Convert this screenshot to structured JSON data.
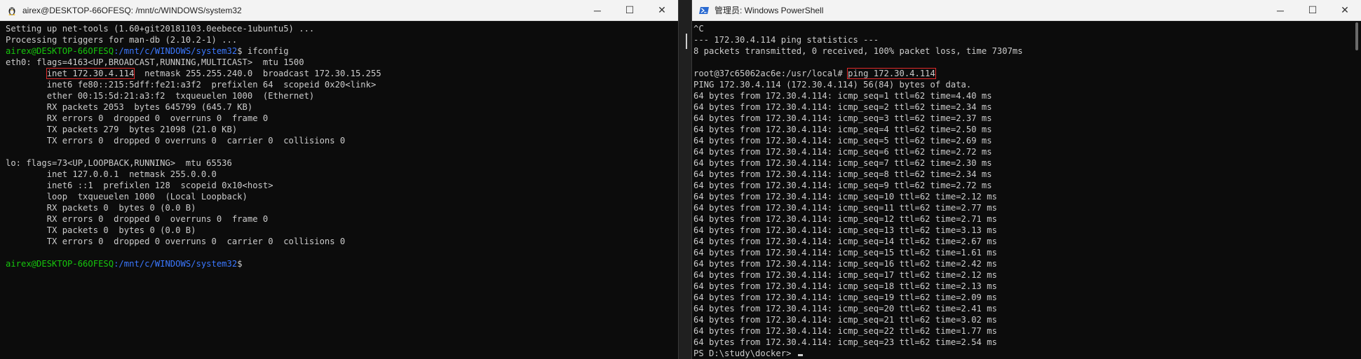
{
  "left_window": {
    "title": "airex@DESKTOP-66OFESQ: /mnt/c/WINDOWS/system32",
    "icon": "linux-penguin-icon",
    "controls": {
      "minimize": "─",
      "maximize": "☐",
      "close": "✕"
    },
    "lines": [
      "Setting up net-tools (1.60+git20181103.0eebece-1ubuntu5) ...",
      "Processing triggers for man-db (2.10.2-1) ...",
      {
        "user": "airex@DESKTOP-66OFESQ",
        "path": ":/mnt/c/WINDOWS/system32",
        "cmd": "$ ifconfig"
      },
      "eth0: flags=4163<UP,BROADCAST,RUNNING,MULTICAST>  mtu 1500",
      {
        "indent": "        ",
        "hl": "inet 172.30.4.114",
        "rest": "  netmask 255.255.240.0  broadcast 172.30.15.255"
      },
      "        inet6 fe80::215:5dff:fe21:a3f2  prefixlen 64  scopeid 0x20<link>",
      "        ether 00:15:5d:21:a3:f2  txqueuelen 1000  (Ethernet)",
      "        RX packets 2053  bytes 645799 (645.7 KB)",
      "        RX errors 0  dropped 0  overruns 0  frame 0",
      "        TX packets 279  bytes 21098 (21.0 KB)",
      "        TX errors 0  dropped 0 overruns 0  carrier 0  collisions 0",
      "",
      "lo: flags=73<UP,LOOPBACK,RUNNING>  mtu 65536",
      "        inet 127.0.0.1  netmask 255.0.0.0",
      "        inet6 ::1  prefixlen 128  scopeid 0x10<host>",
      "        loop  txqueuelen 1000  (Local Loopback)",
      "        RX packets 0  bytes 0 (0.0 B)",
      "        RX errors 0  dropped 0  overruns 0  frame 0",
      "        TX packets 0  bytes 0 (0.0 B)",
      "        TX errors 0  dropped 0 overruns 0  carrier 0  collisions 0",
      "",
      {
        "user": "airex@DESKTOP-66OFESQ",
        "path": ":/mnt/c/WINDOWS/system32",
        "cmd": "$"
      }
    ]
  },
  "right_window": {
    "title": "管理员: Windows PowerShell",
    "icon": "powershell-icon",
    "controls": {
      "minimize": "─",
      "maximize": "☐",
      "close": "✕"
    },
    "lines": [
      "^C",
      "--- 172.30.4.114 ping statistics ---",
      "8 packets transmitted, 0 received, 100% packet loss, time 7307ms",
      "",
      {
        "prefix": "root@37c65062ac6e:/usr/local# ",
        "hl": "ping 172.30.4.114"
      },
      "PING 172.30.4.114 (172.30.4.114) 56(84) bytes of data.",
      "64 bytes from 172.30.4.114: icmp_seq=1 ttl=62 time=4.40 ms",
      "64 bytes from 172.30.4.114: icmp_seq=2 ttl=62 time=2.34 ms",
      "64 bytes from 172.30.4.114: icmp_seq=3 ttl=62 time=2.37 ms",
      "64 bytes from 172.30.4.114: icmp_seq=4 ttl=62 time=2.50 ms",
      "64 bytes from 172.30.4.114: icmp_seq=5 ttl=62 time=2.69 ms",
      "64 bytes from 172.30.4.114: icmp_seq=6 ttl=62 time=2.72 ms",
      "64 bytes from 172.30.4.114: icmp_seq=7 ttl=62 time=2.30 ms",
      "64 bytes from 172.30.4.114: icmp_seq=8 ttl=62 time=2.34 ms",
      "64 bytes from 172.30.4.114: icmp_seq=9 ttl=62 time=2.72 ms",
      "64 bytes from 172.30.4.114: icmp_seq=10 ttl=62 time=2.12 ms",
      "64 bytes from 172.30.4.114: icmp_seq=11 ttl=62 time=2.77 ms",
      "64 bytes from 172.30.4.114: icmp_seq=12 ttl=62 time=2.71 ms",
      "64 bytes from 172.30.4.114: icmp_seq=13 ttl=62 time=3.13 ms",
      "64 bytes from 172.30.4.114: icmp_seq=14 ttl=62 time=2.67 ms",
      "64 bytes from 172.30.4.114: icmp_seq=15 ttl=62 time=1.61 ms",
      "64 bytes from 172.30.4.114: icmp_seq=16 ttl=62 time=2.42 ms",
      "64 bytes from 172.30.4.114: icmp_seq=17 ttl=62 time=2.12 ms",
      "64 bytes from 172.30.4.114: icmp_seq=18 ttl=62 time=2.13 ms",
      "64 bytes from 172.30.4.114: icmp_seq=19 ttl=62 time=2.09 ms",
      "64 bytes from 172.30.4.114: icmp_seq=20 ttl=62 time=2.41 ms",
      "64 bytes from 172.30.4.114: icmp_seq=21 ttl=62 time=3.02 ms",
      "64 bytes from 172.30.4.114: icmp_seq=22 ttl=62 time=1.77 ms",
      "64 bytes from 172.30.4.114: icmp_seq=23 ttl=62 time=2.54 ms",
      {
        "prefix": "PS D:\\study\\docker> ",
        "cursor": true
      }
    ]
  },
  "colors": {
    "terminal_bg": "#0c0c0c",
    "terminal_fg": "#cccccc",
    "prompt_user": "#16c60c",
    "prompt_path": "#3b78ff",
    "highlight_box": "#e02b2b"
  }
}
